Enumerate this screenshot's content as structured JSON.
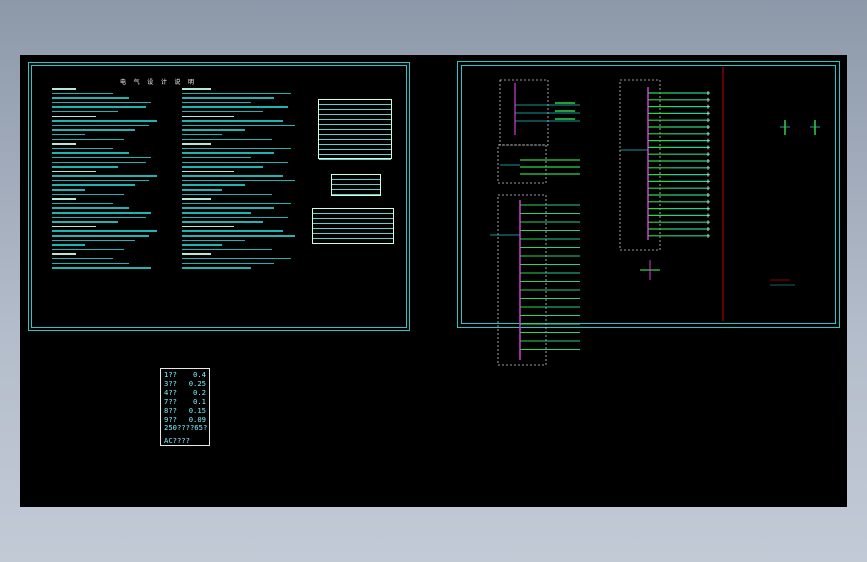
{
  "sheet_left": {
    "title": "电 气 设 计 说 明"
  },
  "legend": {
    "rows": [
      {
        "label": "1??",
        "value": "0.4"
      },
      {
        "label": "3??",
        "value": "0.25"
      },
      {
        "label": "4??",
        "value": "0.2"
      },
      {
        "label": "7??",
        "value": "0.1"
      },
      {
        "label": "8??",
        "value": "0.15"
      },
      {
        "label": "9??",
        "value": "0.09"
      },
      {
        "label": "250??",
        "value": "??65?"
      }
    ],
    "total": "AC????"
  },
  "colors": {
    "canvas": "#000000",
    "frame": "#27c7c7",
    "text_cyan": "#22c7c7",
    "magenta": "#d03cd0",
    "green": "#32d24a",
    "red": "#c80000"
  }
}
